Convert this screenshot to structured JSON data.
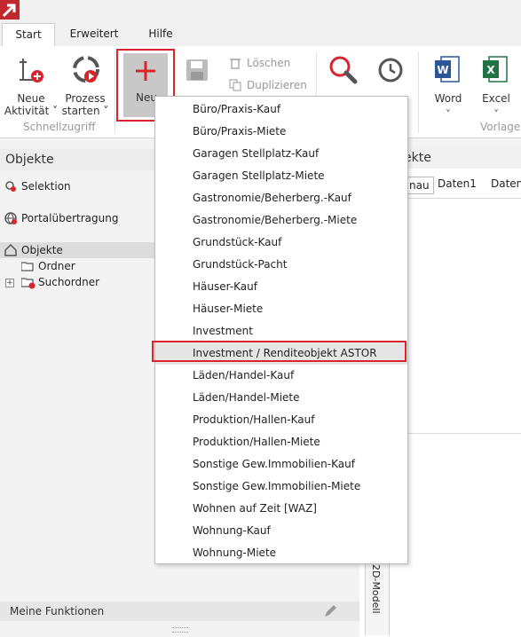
{
  "tabs": [
    {
      "label": "Start",
      "active": true
    },
    {
      "label": "Erweitert",
      "active": false
    },
    {
      "label": "Hilfe",
      "active": false
    }
  ],
  "ribbon": {
    "neue_aktivitaet": {
      "line1": "Neue",
      "line2": "Aktivität ˅"
    },
    "prozess_starten": {
      "line1": "Prozess",
      "line2": "starten ˅"
    },
    "neu": "Neu",
    "loeschen": "Löschen",
    "duplizieren": "Duplizieren",
    "word": "Word",
    "excel": "Excel",
    "chevron": "˅",
    "group_schnellzugriff": "Schnellzugriff",
    "group_vorlagen": "Vorlage"
  },
  "left_panel": {
    "header": "Objekte",
    "selektion": "Selektion",
    "portal": "Portalübertragung",
    "objekte": "Objekte",
    "ordner": "Ordner",
    "suchordner": "Suchordner",
    "meine_funktionen": "Meine Funktionen"
  },
  "right_panel": {
    "header_fragment": "ekte",
    "tab_fragment": "nau",
    "tab_daten1": "Daten1",
    "tab_daten_fragment": "Daten",
    "vertical_label": "2D-Modell"
  },
  "menu": {
    "items": [
      "Büro/Praxis-Kauf",
      "Büro/Praxis-Miete",
      "Garagen Stellplatz-Kauf",
      "Garagen Stellplatz-Miete",
      "Gastronomie/Beherberg.-Kauf",
      "Gastronomie/Beherberg.-Miete",
      "Grundstück-Kauf",
      "Grundstück-Pacht",
      "Häuser-Kauf",
      "Häuser-Miete",
      "Investment",
      "Investment / Renditeobjekt ASTOR",
      "Läden/Handel-Kauf",
      "Läden/Handel-Miete",
      "Produktion/Hallen-Kauf",
      "Produktion/Hallen-Miete",
      "Sonstige Gew.Immobilien-Kauf",
      "Sonstige Gew.Immobilien-Miete",
      "Wohnen auf Zeit [WAZ]",
      "Wohnung-Kauf",
      "Wohnung-Miete"
    ],
    "highlighted_index": 11
  },
  "colors": {
    "accent_red": "#d9242c",
    "word_blue": "#2b579a",
    "excel_green": "#217346"
  }
}
